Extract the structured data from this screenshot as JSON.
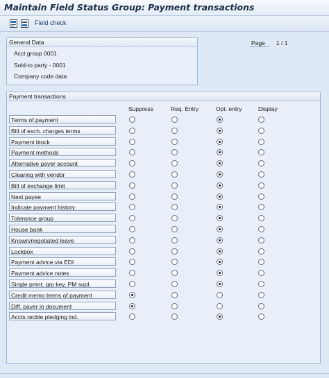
{
  "window": {
    "title": "Maintain Field Status Group: Payment transactions"
  },
  "toolbar": {
    "icons": [
      "previous-page-icon",
      "next-page-icon"
    ],
    "field_check_label": "Field check"
  },
  "general_data": {
    "header": "General Data",
    "acct_group": "Acct group   0001",
    "sold_to_party": "Sold-to party - 0001",
    "company_code_data": "Company code data"
  },
  "paging": {
    "label": "Page",
    "value": "1 / 1"
  },
  "payment_transactions": {
    "header": "Payment transactions",
    "columns": [
      "Suppress",
      "Req. Entry",
      "Opt. entry",
      "Display"
    ],
    "rows": [
      {
        "label": "Terms of payment",
        "selected": 2
      },
      {
        "label": "Bill of exch. charges terms",
        "selected": 2
      },
      {
        "label": "Payment block",
        "selected": 2
      },
      {
        "label": "Payment methods",
        "selected": 2
      },
      {
        "label": "Alternative payer account",
        "selected": 2
      },
      {
        "label": "Clearing with vendor",
        "selected": 2
      },
      {
        "label": "Bill of exchange limit",
        "selected": 2
      },
      {
        "label": "Next payee",
        "selected": 2
      },
      {
        "label": "Indicate payment history",
        "selected": 2
      },
      {
        "label": "Tolerance group",
        "selected": 2
      },
      {
        "label": "House bank",
        "selected": 2
      },
      {
        "label": "Known/negotiated leave",
        "selected": 2
      },
      {
        "label": "Lockbox",
        "selected": 2
      },
      {
        "label": "Payment advice via EDI",
        "selected": 2
      },
      {
        "label": "Payment advice notes",
        "selected": 2
      },
      {
        "label": "Single pmnt, grp key, PM supl.",
        "selected": 2
      },
      {
        "label": "Credit memo terms of payment",
        "selected": 0
      },
      {
        "label": "Diff. payer in document",
        "selected": 0
      },
      {
        "label": "Accts recble pledging ind.",
        "selected": 2
      }
    ]
  }
}
